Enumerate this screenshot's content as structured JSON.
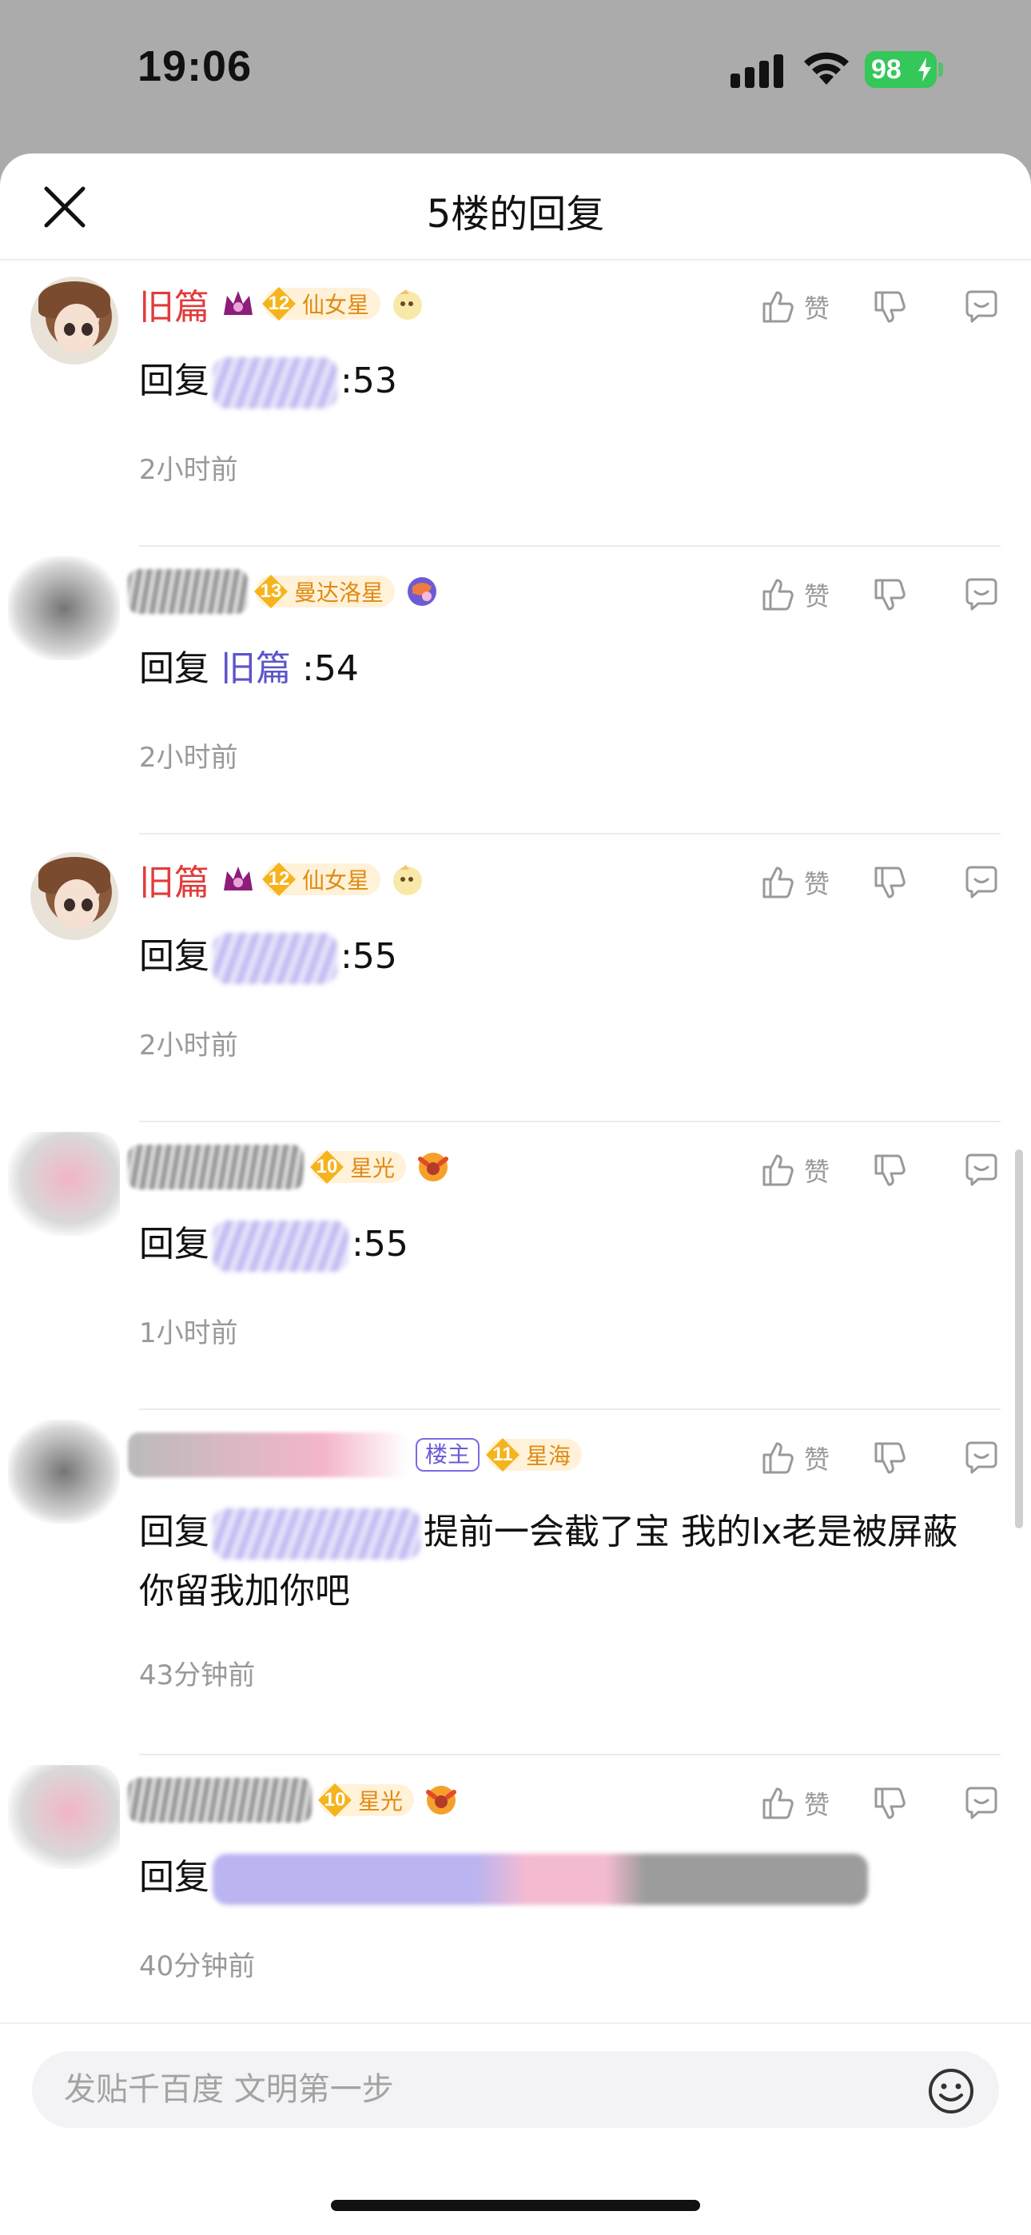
{
  "status_bar": {
    "time": "19:06",
    "battery": "98"
  },
  "sheet": {
    "title": "5楼的回复"
  },
  "actions": {
    "like_label": "赞"
  },
  "replies": [
    {
      "username": "旧篇",
      "level": "12",
      "level_name": "仙女星",
      "reply_prefix": "回复",
      "reply_suffix": ":53",
      "time": "2小时前"
    },
    {
      "level": "13",
      "level_name": "曼达洛星",
      "reply_prefix": "回复",
      "mention": "旧篇",
      "reply_suffix": ":54",
      "time": "2小时前"
    },
    {
      "username": "旧篇",
      "level": "12",
      "level_name": "仙女星",
      "reply_prefix": "回复",
      "reply_suffix": ":55",
      "time": "2小时前"
    },
    {
      "level": "10",
      "level_name": "星光",
      "reply_prefix": "回复",
      "reply_suffix": ":55",
      "time": "1小时前"
    },
    {
      "owner_badge": "楼主",
      "level": "11",
      "level_name": "星海",
      "reply_prefix": "回复",
      "reply_suffix": "提前一会截了宝 我的lx老是被屏蔽 你留我加你吧",
      "time": "43分钟前"
    },
    {
      "level": "10",
      "level_name": "星光",
      "reply_prefix": "回复",
      "time": "40分钟前"
    }
  ],
  "input": {
    "placeholder": "发贴千百度 文明第一步"
  },
  "colors": {
    "username": "#e23b3b",
    "mention": "#5b54c8",
    "level_badge": "#f5b41e",
    "battery": "#34c759"
  },
  "icons": [
    "close-icon",
    "crown-icon",
    "thumbs-up-icon",
    "thumbs-down-icon",
    "comment-icon",
    "emoji-icon"
  ]
}
